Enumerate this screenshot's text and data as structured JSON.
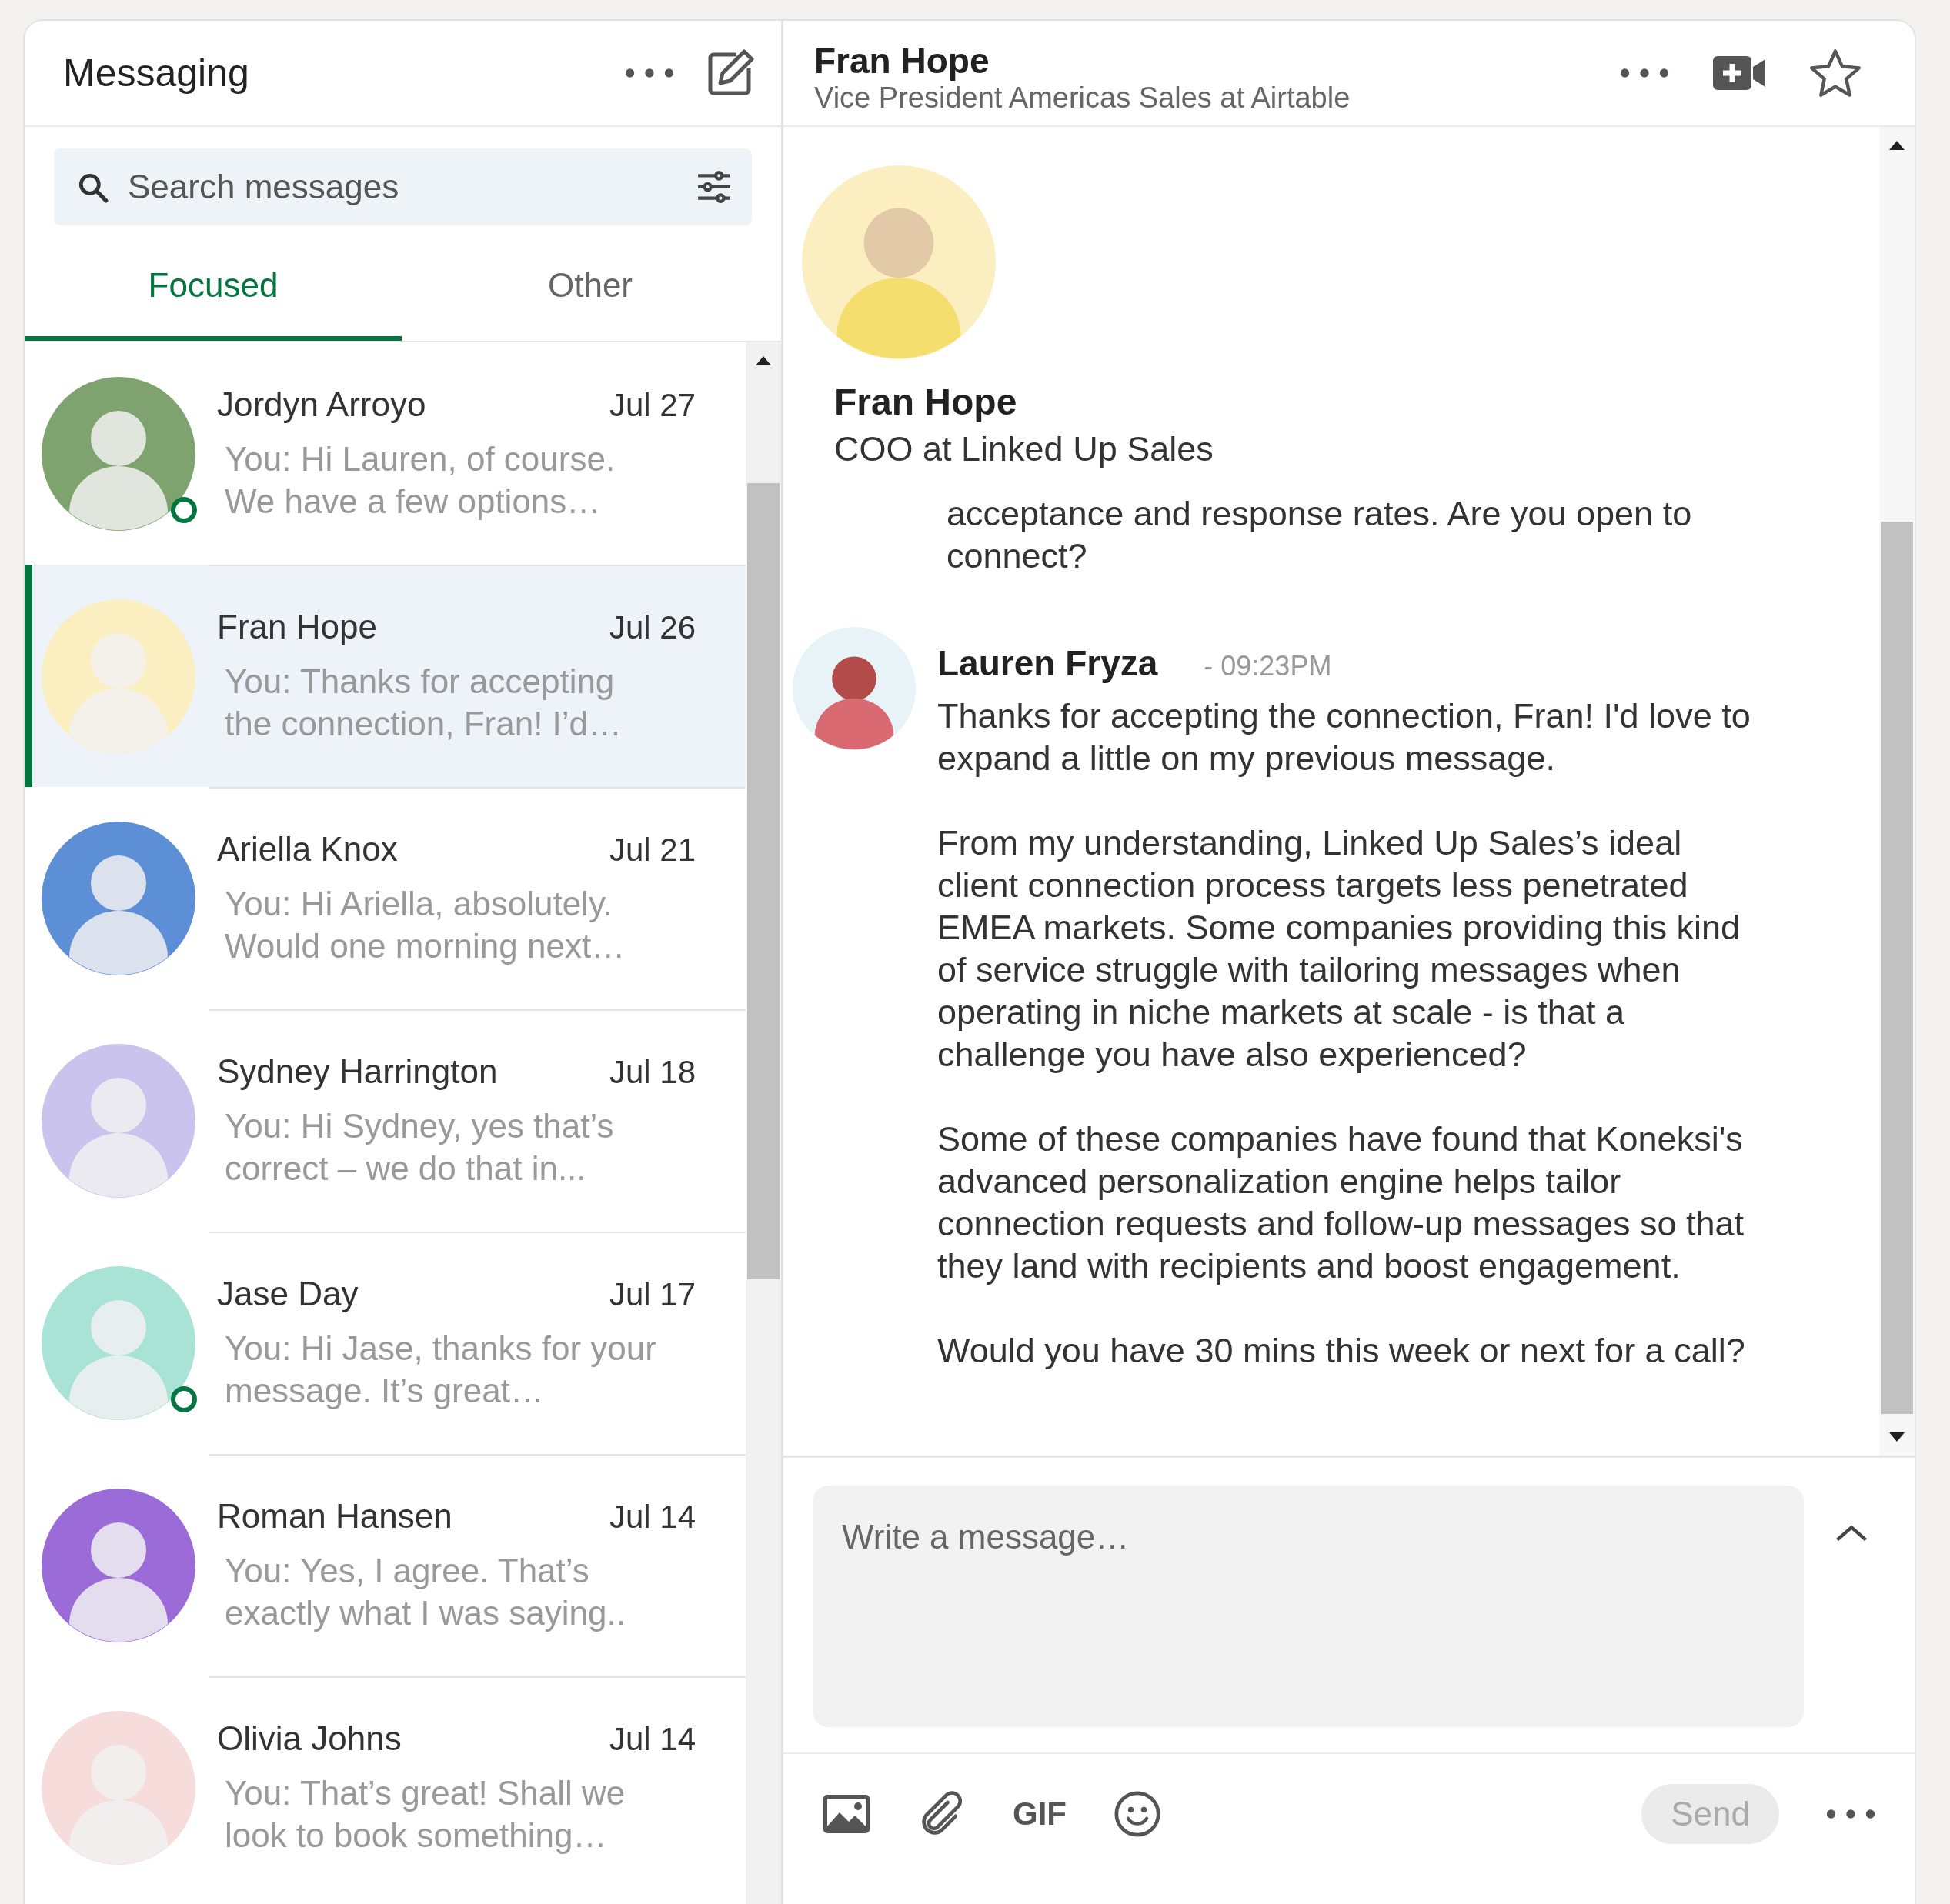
{
  "sidebar": {
    "title": "Messaging",
    "search": {
      "placeholder": "Search messages"
    },
    "tabs": [
      {
        "label": "Focused",
        "selected": true
      },
      {
        "label": "Other",
        "selected": false
      }
    ],
    "conversations": [
      {
        "name": "Jordyn Arroyo",
        "date": "Jul 27",
        "preview": "You: Hi Lauren, of course. We have a few options…",
        "selected": false,
        "online": true
      },
      {
        "name": "Fran Hope",
        "date": "Jul 26",
        "preview": "You: Thanks for accepting the connection, Fran! I’d…",
        "selected": true,
        "online": false
      },
      {
        "name": "Ariella Knox",
        "date": "Jul 21",
        "preview": "You: Hi Ariella, absolutely. Would one morning next…",
        "selected": false,
        "online": false
      },
      {
        "name": "Sydney Harrington",
        "date": "Jul 18",
        "preview": "You: Hi Sydney, yes that’s correct – we do that in...",
        "selected": false,
        "online": false
      },
      {
        "name": "Jase Day",
        "date": "Jul 17",
        "preview": "You: Hi Jase, thanks for your message. It’s great…",
        "selected": false,
        "online": true
      },
      {
        "name": "Roman Hansen",
        "date": "Jul 14",
        "preview": "You: Yes, I agree. That’s exactly what I was saying..",
        "selected": false,
        "online": false
      },
      {
        "name": "Olivia Johns",
        "date": "Jul 14",
        "preview": "You: That’s great! Shall we look to book something…",
        "selected": false,
        "online": false
      }
    ]
  },
  "conversation": {
    "name": "Fran Hope",
    "headline": "Vice President Americas Sales at Airtable",
    "profile": {
      "name": "Fran Hope",
      "headline": "COO at Linked Up Sales"
    },
    "messages": [
      {
        "kind": "continuation",
        "paragraphs": [
          "acceptance and response rates. Are you open to connect?"
        ]
      },
      {
        "kind": "group",
        "sender": "Lauren Fryza",
        "time": "- 09:23PM",
        "paragraphs": [
          "Thanks for accepting the connection, Fran! I'd love to expand a little on my previous message.",
          "From my understanding, Linked Up Sales’s ideal client connection process targets less penetrated EMEA markets. Some companies providing this kind of service struggle with tailoring messages when operating in niche markets at scale - is that a challenge you have also experienced?",
          "Some of these companies have found that Koneksi's advanced personalization engine helps tailor connection requests and follow-up messages so that they land with recipients and boost engagement.",
          "Would you have 30 mins this week or next for a call?"
        ]
      }
    ]
  },
  "composer": {
    "placeholder": "Write a message…",
    "gif_label": "GIF",
    "send": {
      "label": "Send",
      "disabled": true
    }
  }
}
